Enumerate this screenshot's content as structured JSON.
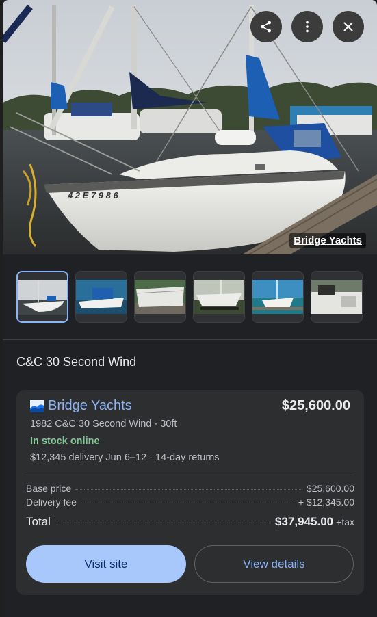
{
  "hero": {
    "credit": "Bridge Yachts",
    "hull_number": "4 2 E 7 9 8 6",
    "actions": [
      "share-icon",
      "more-vert-icon",
      "close-icon"
    ]
  },
  "thumbnails": [
    {
      "name": "sailboat-docked",
      "active": true
    },
    {
      "name": "boat-cockpit-cover",
      "active": false
    },
    {
      "name": "boat-hull-side",
      "active": false
    },
    {
      "name": "boat-on-trailer",
      "active": false
    },
    {
      "name": "boat-marina-aerial",
      "active": false
    },
    {
      "name": "boat-interior",
      "active": false
    }
  ],
  "product": {
    "title": "C&C 30 Second Wind"
  },
  "offer": {
    "merchant": "Bridge Yachts",
    "price": "$25,600.00",
    "listing": "1982 C&C 30 Second Wind - 30ft",
    "stock": "In stock online",
    "delivery": "$12,345 delivery Jun 6–12",
    "delivery_sep": "·",
    "returns": "14-day returns",
    "breakdown": {
      "base_label": "Base price",
      "base_value": "$25,600.00",
      "fee_label": "Delivery fee",
      "fee_value": "+ $12,345.00",
      "total_label": "Total",
      "total_value": "$37,945.00",
      "total_suffix": "+tax"
    },
    "buttons": {
      "visit": "Visit site",
      "details": "View details"
    }
  },
  "colors": {
    "accent": "#8ab4f8",
    "primary_button": "#a8c7fa",
    "in_stock": "#81c995",
    "card_bg": "#2d2e30"
  }
}
